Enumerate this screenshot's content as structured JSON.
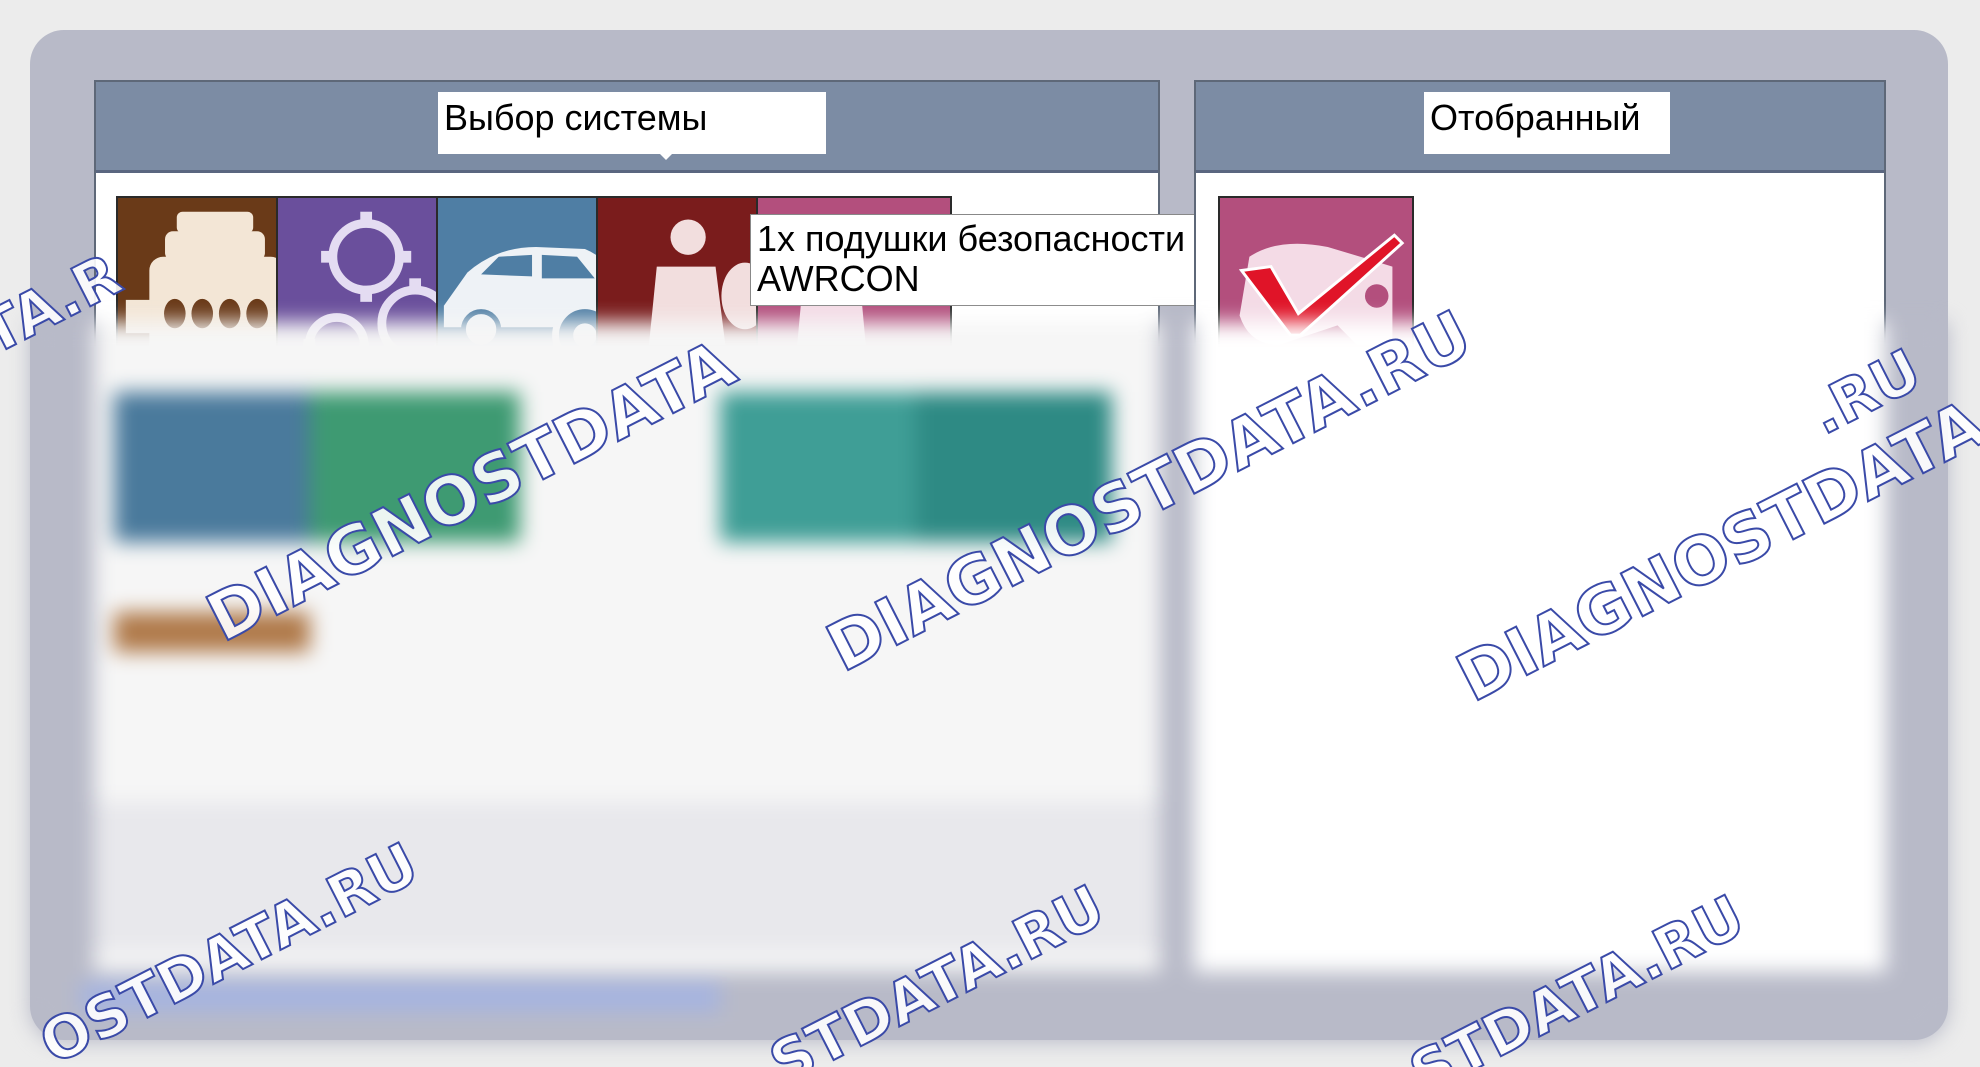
{
  "left_panel": {
    "title": "Выбор системы"
  },
  "right_panel": {
    "title": "Отобранный"
  },
  "tooltip": {
    "line1": "1x подушки безопасности",
    "line2": "AWRCON"
  },
  "tiles": [
    {
      "name": "engine-icon",
      "color": "#6a3a18"
    },
    {
      "name": "gears-icon",
      "color": "#6a4f9c"
    },
    {
      "name": "car-brake-icon",
      "color": "#4f7ea4"
    },
    {
      "name": "airbag-icon",
      "color": "#7a1c1c"
    },
    {
      "name": "seat-icon",
      "color": "#b34f7d"
    }
  ],
  "selected_tile": {
    "name": "airbag-selected-icon",
    "color": "#b34f7d",
    "check_color": "#e01428"
  },
  "watermark": {
    "text_full": "DIAGNOSTDATA",
    "text_ru": "DIAGNOSTDATA.RU",
    "text_domain": ".RU",
    "frag1": "OSTDATA.RU",
    "frag2": "STDATA.RU",
    "frag3": "STDATA.RU",
    "frag4": "TA.R"
  },
  "colors": {
    "frame": "#b8bac8",
    "panel_header": "#7c8ca4",
    "panel_border": "#5e6878"
  }
}
